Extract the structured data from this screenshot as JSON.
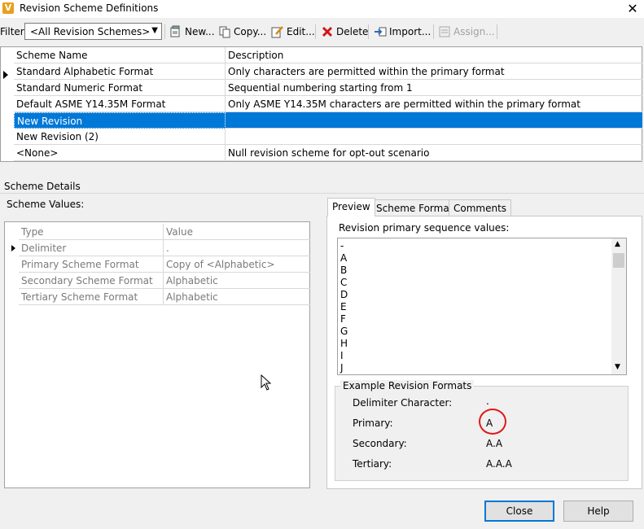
{
  "window": {
    "title": "Revision Scheme Definitions",
    "app_icon": "vault-logo-icon",
    "logo_letter": "V"
  },
  "toolbar": {
    "filter_label": "Filter:",
    "filter_value": "<All Revision Schemes>",
    "new_label": "New...",
    "copy_label": "Copy...",
    "edit_label": "Edit...",
    "delete_label": "Delete",
    "import_label": "Import...",
    "assign_label": "Assign..."
  },
  "schemes": {
    "headers": [
      "Scheme Name",
      "Description"
    ],
    "rows": [
      {
        "name": "Standard Alphabetic Format",
        "description": "Only characters are permitted within the primary format"
      },
      {
        "name": "Standard Numeric Format",
        "description": "Sequential numbering starting from 1"
      },
      {
        "name": "Default ASME Y14.35M Format",
        "description": "Only ASME Y14.35M characters are permitted within the primary format"
      },
      {
        "name": "New Revision",
        "description": ""
      },
      {
        "name": "New Revision (2)",
        "description": ""
      },
      {
        "name": "<None>",
        "description": "Null revision scheme for opt-out scenario"
      }
    ],
    "selected_row": "New Revision",
    "selection_color": "#0078d7"
  },
  "details": {
    "group_label": "Scheme Details",
    "values_label": "Scheme Values:",
    "headers": [
      "Type",
      "Value"
    ],
    "rows": [
      {
        "type": "Delimiter",
        "value": "."
      },
      {
        "type": "Primary Scheme Format",
        "value": "Copy of <Alphabetic>"
      },
      {
        "type": "Secondary Scheme Format",
        "value": "Alphabetic"
      },
      {
        "type": "Tertiary Scheme Format",
        "value": "Alphabetic"
      }
    ]
  },
  "tabs": [
    "Preview",
    "Scheme Format",
    "Comments"
  ],
  "preview": {
    "sequence_label": "Revision primary sequence values:",
    "sequence_values": [
      "-",
      "A",
      "B",
      "C",
      "D",
      "E",
      "F",
      "G",
      "H",
      "I",
      "J"
    ],
    "example_title": "Example Revision Formats",
    "delimiter_label": "Delimiter Character:",
    "delimiter_value": ".",
    "primary_label": "Primary:",
    "primary_value": "A",
    "secondary_label": "Secondary:",
    "secondary_value": "A.A",
    "tertiary_label": "Tertiary:",
    "tertiary_value": "A.A.A",
    "highlight_color": "#e01818"
  },
  "buttons": {
    "close": "Close",
    "help": "Help"
  }
}
